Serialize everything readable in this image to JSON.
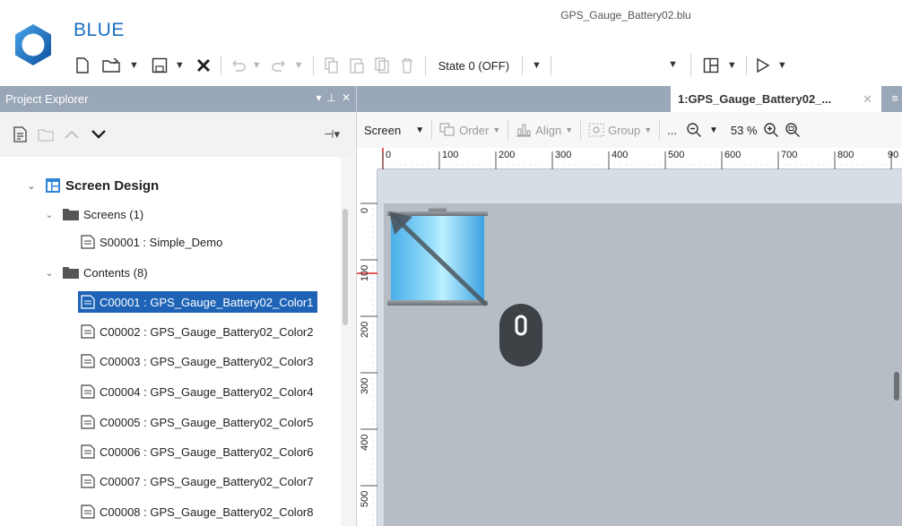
{
  "app": {
    "name": "BLUE",
    "file_title": "GPS_Gauge_Battery02.blu"
  },
  "toolbar": {
    "state_label": "State 0 (OFF)",
    "blank_combo_value": ""
  },
  "project_explorer": {
    "title": "Project Explorer",
    "tree": {
      "root_label": "Screen Design",
      "screens_folder": "Screens (1)",
      "screens": [
        "S00001 : Simple_Demo"
      ],
      "contents_folder": "Contents (8)",
      "contents": [
        "C00001 : GPS_Gauge_Battery02_Color1",
        "C00002 : GPS_Gauge_Battery02_Color2",
        "C00003 : GPS_Gauge_Battery02_Color3",
        "C00004 : GPS_Gauge_Battery02_Color4",
        "C00005 : GPS_Gauge_Battery02_Color5",
        "C00006 : GPS_Gauge_Battery02_Color6",
        "C00007 : GPS_Gauge_Battery02_Color7",
        "C00008 : GPS_Gauge_Battery02_Color8"
      ],
      "selected_content_index": 0
    }
  },
  "document": {
    "tab_label": "1:GPS_Gauge_Battery02_...",
    "screen_toolbar": {
      "screen_label": "Screen",
      "order_label": "Order",
      "align_label": "Align",
      "group_label": "Group",
      "more_label": "...",
      "zoom_label": "53 %"
    },
    "ruler_h": [
      "0",
      "100",
      "200",
      "300",
      "400",
      "500",
      "600",
      "700",
      "800",
      "90"
    ],
    "ruler_v": [
      "0",
      "100",
      "200",
      "300",
      "400",
      "500"
    ]
  },
  "colors": {
    "brand": "#1c6fc0",
    "panel_header": "#9aa7b8",
    "selection": "#1e63b6",
    "canvas": "#b6bdc5"
  }
}
